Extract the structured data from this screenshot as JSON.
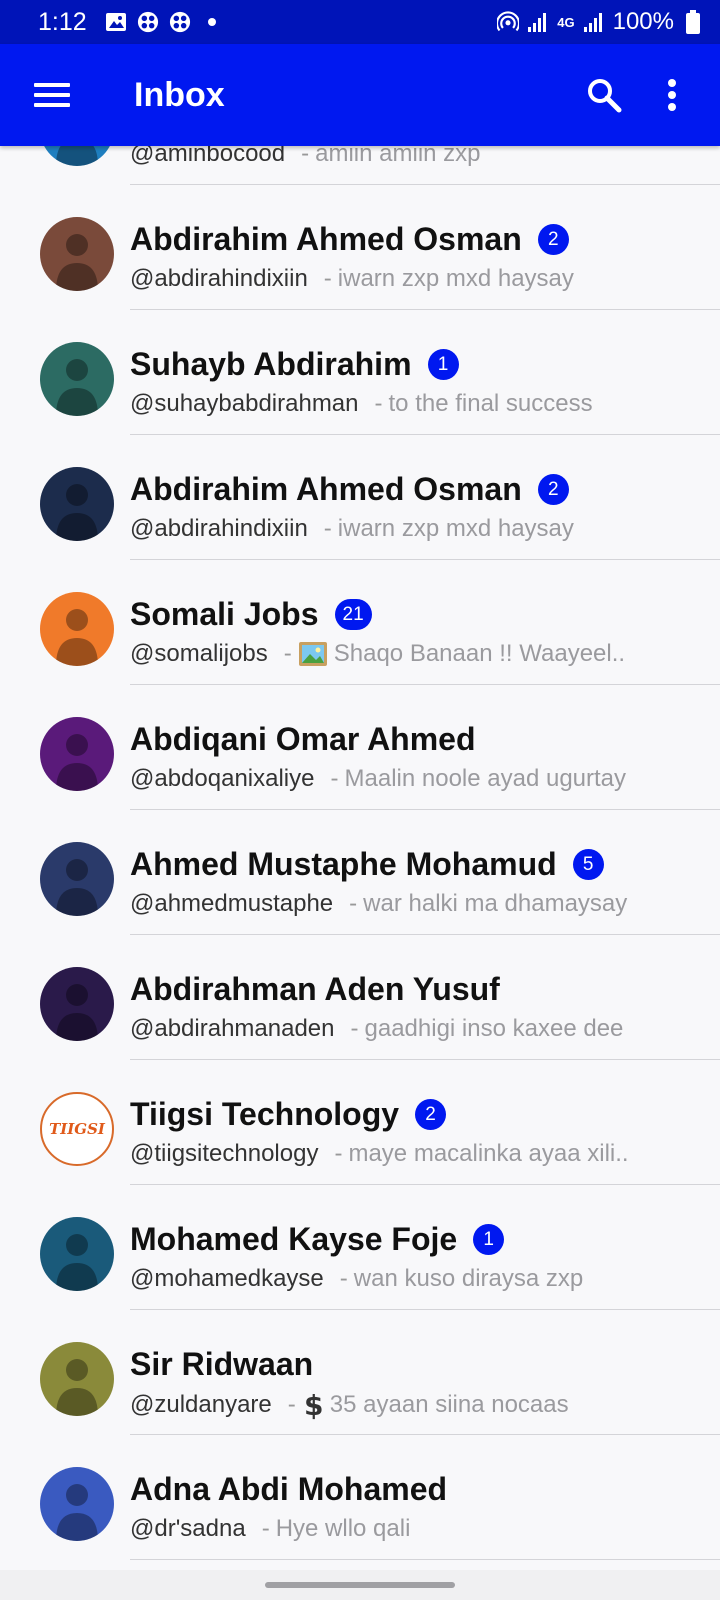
{
  "status_bar": {
    "time": "1:12",
    "battery": "100%",
    "network_label": "4G"
  },
  "app_bar": {
    "title": "Inbox"
  },
  "conversations": [
    {
      "name": "",
      "handle": "@aminbocood",
      "preview": "amiin amiin zxp",
      "badge": "",
      "avatar_color": "#1f7fc0"
    },
    {
      "name": "Abdirahim Ahmed Osman",
      "handle": "@abdirahindixiin",
      "preview": "iwarn zxp mxd haysay",
      "badge": "2",
      "avatar_color": "#7a4a3a"
    },
    {
      "name": "Suhayb Abdirahim",
      "handle": "@suhaybabdirahman",
      "preview": "to the final success",
      "badge": "1",
      "avatar_color": "#2c6b63"
    },
    {
      "name": "Abdirahim Ahmed Osman",
      "handle": "@abdirahindixiin",
      "preview": "iwarn zxp mxd haysay",
      "badge": "2",
      "avatar_color": "#1c2c4c"
    },
    {
      "name": "Somali Jobs",
      "handle": "@somalijobs",
      "preview": "Shaqo Banaan !! Waayeel..",
      "badge": "21",
      "avatar_color": "#f07a2a",
      "preview_icon": "image-icon"
    },
    {
      "name": "Abdiqani Omar Ahmed",
      "handle": "@abdoqanixaliye",
      "preview": "Maalin noole ayad ugurtay",
      "badge": "",
      "avatar_color": "#5a1a7a"
    },
    {
      "name": "Ahmed Mustaphe Mohamud",
      "handle": "@ahmedmustaphe",
      "preview": "war halki ma dhamaysay",
      "badge": "5",
      "avatar_color": "#2a3a6a"
    },
    {
      "name": "Abdirahman Aden Yusuf",
      "handle": "@abdirahmanaden",
      "preview": "gaadhigi inso kaxee dee",
      "badge": "",
      "avatar_color": "#2a1a4a"
    },
    {
      "name": "Tiigsi Technology",
      "handle": "@tiigsitechnology",
      "preview": "maye macalinka ayaa xili..",
      "badge": "2",
      "avatar_color": "#ffffff",
      "avatar_text": "TIIGSI"
    },
    {
      "name": "Mohamed Kayse Foje",
      "handle": "@mohamedkayse",
      "preview": "wan kuso diraysa zxp",
      "badge": "1",
      "avatar_color": "#1a5a7a"
    },
    {
      "name": "Sir Ridwaan",
      "handle": "@zuldanyare",
      "preview": "35 ayaan siina nocaas",
      "badge": "",
      "avatar_color": "#8a8a3a",
      "preview_icon": "dollar-icon"
    },
    {
      "name": "Adna Abdi Mohamed",
      "handle": "@dr'sadna",
      "preview": "Hye wllo qali",
      "badge": "",
      "avatar_color": "#3a5ac0"
    }
  ]
}
